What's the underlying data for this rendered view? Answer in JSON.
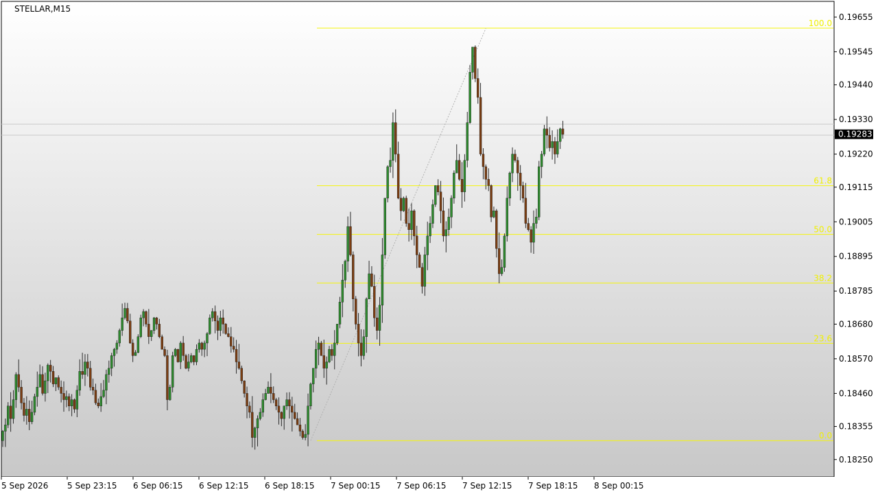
{
  "window": {
    "symbol_label": "STELLAR,M15"
  },
  "colors": {
    "bull": "#2e8b2e",
    "bear": "#7a3d12",
    "wick": "#2a2a2a",
    "fib": "#f5f50a",
    "grid": "#c8c8c8",
    "price_tag_bg": "#000000",
    "price_tag_fg": "#ffffff"
  },
  "chart_data": {
    "type": "candlestick",
    "symbol": "STELLAR",
    "timeframe": "M15",
    "ylim": [
      0.18195,
      0.19705
    ],
    "y_ticks": [
      "0.19655",
      "0.19545",
      "0.19440",
      "0.19330",
      "0.19220",
      "0.19115",
      "0.19005",
      "0.18895",
      "0.18785",
      "0.18680",
      "0.18570",
      "0.18460",
      "0.18355",
      "0.18250"
    ],
    "x_ticks": [
      "5 Sep 2026",
      "5 Sep 23:15",
      "6 Sep 06:15",
      "6 Sep 12:15",
      "6 Sep 18:15",
      "7 Sep 00:15",
      "7 Sep 06:15",
      "7 Sep 12:15",
      "7 Sep 18:15",
      "8 Sep 00:15"
    ],
    "current_price": "0.19283",
    "fibonacci": {
      "high": 0.1962,
      "low": 0.1831,
      "levels": [
        {
          "label": "100.0",
          "ratio": 1.0
        },
        {
          "label": "61.8",
          "ratio": 0.618
        },
        {
          "label": "50.0",
          "ratio": 0.5
        },
        {
          "label": "38.2",
          "ratio": 0.382
        },
        {
          "label": "23.6",
          "ratio": 0.236
        },
        {
          "label": "0.0",
          "ratio": 0.0
        }
      ]
    },
    "series_close": [
      0.1834,
      0.1836,
      0.1842,
      0.1838,
      0.1844,
      0.1852,
      0.1848,
      0.1843,
      0.1839,
      0.1841,
      0.1837,
      0.184,
      0.1845,
      0.1848,
      0.1852,
      0.1846,
      0.185,
      0.1855,
      0.1853,
      0.1849,
      0.1851,
      0.1848,
      0.1846,
      0.1844,
      0.1845,
      0.1842,
      0.1844,
      0.1841,
      0.1847,
      0.1853,
      0.1852,
      0.1856,
      0.1854,
      0.1848,
      0.1847,
      0.1843,
      0.1842,
      0.1845,
      0.1847,
      0.1852,
      0.1854,
      0.1858,
      0.186,
      0.1862,
      0.1866,
      0.187,
      0.1873,
      0.1869,
      0.1862,
      0.1858,
      0.1859,
      0.1864,
      0.187,
      0.1872,
      0.1868,
      0.1864,
      0.1866,
      0.187,
      0.1868,
      0.1864,
      0.186,
      0.1858,
      0.1844,
      0.1848,
      0.1858,
      0.186,
      0.1856,
      0.1862,
      0.1858,
      0.1854,
      0.1856,
      0.1858,
      0.1856,
      0.186,
      0.1862,
      0.186,
      0.1862,
      0.1865,
      0.187,
      0.1872,
      0.1869,
      0.1866,
      0.187,
      0.1868,
      0.1865,
      0.1864,
      0.1861,
      0.186,
      0.1856,
      0.1854,
      0.185,
      0.1846,
      0.1842,
      0.184,
      0.1832,
      0.1835,
      0.1838,
      0.184,
      0.1844,
      0.1846,
      0.1848,
      0.1846,
      0.1844,
      0.1842,
      0.184,
      0.1838,
      0.1842,
      0.1844,
      0.1842,
      0.184,
      0.1838,
      0.1836,
      0.1834,
      0.1832,
      0.1833,
      0.1842,
      0.1849,
      0.1854,
      0.186,
      0.1862,
      0.1858,
      0.1854,
      0.1856,
      0.186,
      0.1858,
      0.1862,
      0.1868,
      0.1875,
      0.1882,
      0.1888,
      0.1899,
      0.189,
      0.1876,
      0.1868,
      0.1862,
      0.1858,
      0.1864,
      0.1876,
      0.1884,
      0.188,
      0.187,
      0.1866,
      0.1874,
      0.189,
      0.1908,
      0.1918,
      0.192,
      0.1932,
      0.1922,
      0.1908,
      0.1904,
      0.1908,
      0.19,
      0.1898,
      0.1904,
      0.1896,
      0.189,
      0.1886,
      0.188,
      0.189,
      0.1896,
      0.19,
      0.1906,
      0.1912,
      0.191,
      0.1904,
      0.1896,
      0.1898,
      0.1902,
      0.1908,
      0.1916,
      0.192,
      0.1914,
      0.191,
      0.192,
      0.1932,
      0.1948,
      0.1956,
      0.1946,
      0.194,
      0.1922,
      0.1918,
      0.1914,
      0.1912,
      0.1902,
      0.1904,
      0.1892,
      0.1884,
      0.1886,
      0.1896,
      0.1908,
      0.1916,
      0.1922,
      0.192,
      0.1916,
      0.1912,
      0.1908,
      0.19,
      0.1898,
      0.1894,
      0.19,
      0.1902,
      0.1918,
      0.1922,
      0.193,
      0.1928,
      0.1924,
      0.1926,
      0.1922,
      0.1926,
      0.193,
      0.19283
    ],
    "visible_bars": 222,
    "fib_anchor_low_bar": 116,
    "fib_anchor_high_bar": 182
  }
}
